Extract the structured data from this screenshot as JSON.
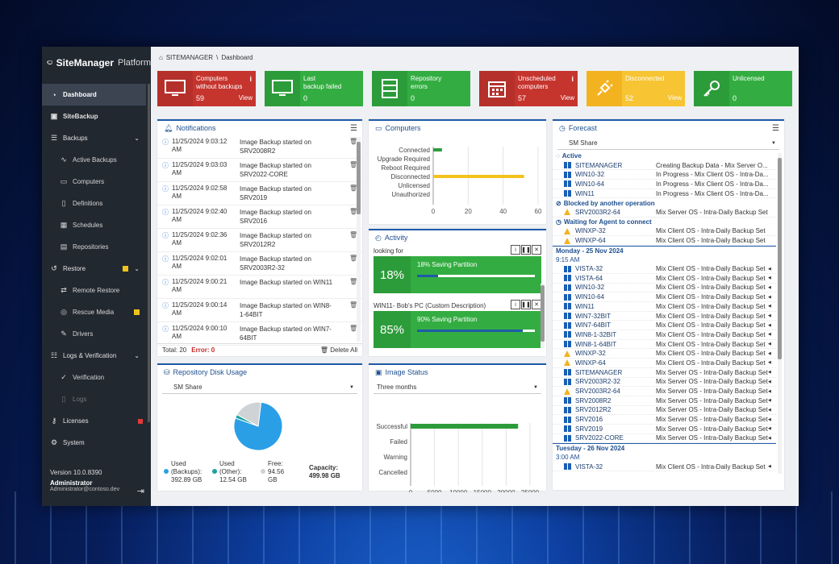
{
  "brand": {
    "name": "SiteManager",
    "suffix": "Platform"
  },
  "breadcrumb": {
    "root": "SITEMANAGER",
    "sep": "\\",
    "current": "Dashboard"
  },
  "sidebar": {
    "items": [
      {
        "label": "Dashboard"
      },
      {
        "label": "SiteBackup"
      },
      {
        "label": "Backups"
      },
      {
        "label": "Active Backups"
      },
      {
        "label": "Computers"
      },
      {
        "label": "Definitions"
      },
      {
        "label": "Schedules"
      },
      {
        "label": "Repositories"
      },
      {
        "label": "Restore"
      },
      {
        "label": "Remote Restore"
      },
      {
        "label": "Rescue Media"
      },
      {
        "label": "Drivers"
      },
      {
        "label": "Logs & Verification"
      },
      {
        "label": "Verification"
      },
      {
        "label": "Logs"
      },
      {
        "label": "Licenses"
      },
      {
        "label": "System"
      }
    ],
    "version": "Version 10.0.8390",
    "user": "Administrator",
    "email": "Administrator@contoso.dev"
  },
  "tiles": [
    {
      "l1": "Computers",
      "l2": "without backups",
      "count": "59",
      "view": "View",
      "alert": "i"
    },
    {
      "l1": "Last",
      "l2": "backup failed",
      "count": "0"
    },
    {
      "l1": "Repository",
      "l2": "errors",
      "count": "0"
    },
    {
      "l1": "Unscheduled",
      "l2": "computers",
      "count": "57",
      "view": "View",
      "alert": "i"
    },
    {
      "l1": "Disconnected",
      "l2": "",
      "count": "52",
      "view": "View"
    },
    {
      "l1": "Unlicensed",
      "l2": "",
      "count": "0"
    }
  ],
  "notifications": {
    "title": "Notifications",
    "items": [
      {
        "t1": "11/25/2024 9:03:12",
        "t2": "AM",
        "m1": "Image Backup started on",
        "m2": "SRV2008R2"
      },
      {
        "t1": "11/25/2024 9:03:03",
        "t2": "AM",
        "m1": "Image Backup started on",
        "m2": "SRV2022-CORE"
      },
      {
        "t1": "11/25/2024 9:02:58",
        "t2": "AM",
        "m1": "Image Backup started on",
        "m2": "SRV2019"
      },
      {
        "t1": "11/25/2024 9:02:40",
        "t2": "AM",
        "m1": "Image Backup started on",
        "m2": "SRV2016"
      },
      {
        "t1": "11/25/2024 9:02:36",
        "t2": "AM",
        "m1": "Image Backup started on",
        "m2": "SRV2012R2"
      },
      {
        "t1": "11/25/2024 9:02:01",
        "t2": "AM",
        "m1": "Image Backup started on",
        "m2": "SRV2003R2-32"
      },
      {
        "t1": "11/25/2024 9:00:21",
        "t2": "AM",
        "m1": "Image Backup started on WIN11",
        "m2": ""
      },
      {
        "t1": "11/25/2024 9:00:14",
        "t2": "AM",
        "m1": "Image Backup started on WIN8-",
        "m2": "1-64BIT"
      },
      {
        "t1": "11/25/2024 9:00:10",
        "t2": "AM",
        "m1": "Image Backup started on WIN7-",
        "m2": "64BIT"
      }
    ],
    "total": "Total: 20",
    "errors": "Error: 0",
    "delete_all": "Delete All"
  },
  "computers": {
    "title": "Computers"
  },
  "activity": {
    "title": "Activity",
    "cut_text": "looking for",
    "items": [
      {
        "pct": "18%",
        "label": "18% Saving Partition",
        "progress": 18
      },
      {
        "title": "WIN11- Bob's PC (Custom Description)",
        "pct": "85%",
        "label": "90% Saving Partition",
        "progress": 90
      }
    ]
  },
  "forecast": {
    "title": "Forecast",
    "select": "SM Share",
    "sec_active": "Active",
    "sec_blocked": "Blocked by another operation",
    "sec_waiting": "Waiting for Agent to connect",
    "day1": "Monday - 25 Nov 2024",
    "time1": "9:15 AM",
    "day2": "Tuesday - 26 Nov 2024",
    "time2": "3:00 AM",
    "active": [
      [
        "SITEMANAGER",
        "Creating Backup Data - Mix Server O..."
      ],
      [
        "WIN10-32",
        "In Progress - Mix Client OS - Intra-Da..."
      ],
      [
        "WIN10-64",
        "In Progress - Mix Client OS - Intra-Da..."
      ],
      [
        "WIN11",
        "In Progress - Mix Client OS - Intra-Da..."
      ]
    ],
    "blocked": [
      [
        "SRV2003R2-64",
        "Mix Server OS - Intra-Daily Backup Set"
      ]
    ],
    "waiting": [
      [
        "WINXP-32",
        "Mix Client OS - Intra-Daily Backup Set"
      ],
      [
        "WINXP-64",
        "Mix Client OS - Intra-Daily Backup Set"
      ]
    ],
    "monday": [
      [
        "VISTA-32",
        "Mix Client OS - Intra-Daily Backup Set",
        "w"
      ],
      [
        "VISTA-64",
        "Mix Client OS - Intra-Daily Backup Set",
        "w"
      ],
      [
        "WIN10-32",
        "Mix Client OS - Intra-Daily Backup Set",
        "w"
      ],
      [
        "WIN10-64",
        "Mix Client OS - Intra-Daily Backup Set",
        "w"
      ],
      [
        "WIN11",
        "Mix Client OS - Intra-Daily Backup Set",
        "w"
      ],
      [
        "WIN7-32BIT",
        "Mix Client OS - Intra-Daily Backup Set",
        "w"
      ],
      [
        "WIN7-64BIT",
        "Mix Client OS - Intra-Daily Backup Set",
        "w"
      ],
      [
        "WIN8-1-32BIT",
        "Mix Client OS - Intra-Daily Backup Set",
        "w"
      ],
      [
        "WIN8-1-64BIT",
        "Mix Client OS - Intra-Daily Backup Set",
        "w"
      ],
      [
        "WINXP-32",
        "Mix Client OS - Intra-Daily Backup Set",
        "a"
      ],
      [
        "WINXP-64",
        "Mix Client OS - Intra-Daily Backup Set",
        "a"
      ],
      [
        "SITEMANAGER",
        "Mix Server OS - Intra-Daily Backup Set",
        "w"
      ],
      [
        "SRV2003R2-32",
        "Mix Server OS - Intra-Daily Backup Set",
        "w"
      ],
      [
        "SRV2003R2-64",
        "Mix Server OS - Intra-Daily Backup Set",
        "a"
      ],
      [
        "SRV2008R2",
        "Mix Server OS - Intra-Daily Backup Set",
        "w"
      ],
      [
        "SRV2012R2",
        "Mix Server OS - Intra-Daily Backup Set",
        "w"
      ],
      [
        "SRV2016",
        "Mix Server OS - Intra-Daily Backup Set",
        "w"
      ],
      [
        "SRV2019",
        "Mix Server OS - Intra-Daily Backup Set",
        "w"
      ],
      [
        "SRV2022-CORE",
        "Mix Server OS - Intra-Daily Backup Set",
        "w"
      ]
    ],
    "tuesday": [
      [
        "VISTA-32",
        "Mix Client OS - Intra-Daily Backup Set",
        "w"
      ]
    ]
  },
  "repo": {
    "title": "Repository Disk Usage",
    "select": "SM Share",
    "legend": [
      {
        "l1": "Used",
        "l2": "(Backups):",
        "v": "392.89 GB",
        "color": "#2b9fe6"
      },
      {
        "l1": "Used",
        "l2": "(Other):",
        "v": "12.54 GB",
        "color": "#1aa3a0"
      },
      {
        "l1": "Free:",
        "l2": "94.56",
        "v": "GB",
        "color": "#cfd3d6"
      }
    ],
    "cap_label": "Capacity:",
    "cap_value": "499.98 GB"
  },
  "image_status": {
    "title": "Image Status",
    "select": "Three months"
  },
  "chart_data": [
    {
      "type": "bar",
      "orientation": "horizontal",
      "categories": [
        "Connected",
        "Upgrade Required",
        "Reboot Required",
        "Disconnected",
        "Unlicensed",
        "Unauthorized"
      ],
      "values": [
        5,
        0,
        0,
        52,
        0,
        0
      ],
      "colors": [
        "#2c9c3a",
        "#2c9c3a",
        "#2c9c3a",
        "#f3c21b",
        "#2c9c3a",
        "#2c9c3a"
      ],
      "xlim": [
        0,
        60
      ],
      "xticks": [
        0,
        20,
        40,
        60
      ]
    },
    {
      "type": "bar",
      "orientation": "horizontal",
      "categories": [
        "Successful",
        "Failed",
        "Warning",
        "Cancelled"
      ],
      "values": [
        22500,
        0,
        0,
        0
      ],
      "colors": [
        "#2c9c3a",
        "#c6342e",
        "#f3b321",
        "#999"
      ],
      "xlim": [
        0,
        25000
      ],
      "xticks": [
        0,
        5000,
        10000,
        15000,
        20000,
        25000
      ]
    },
    {
      "type": "pie",
      "labels": [
        "Used (Backups)",
        "Used (Other)",
        "Free"
      ],
      "values": [
        392.89,
        12.54,
        94.56
      ],
      "colors": [
        "#2b9fe6",
        "#1aa3a0",
        "#cfd3d6"
      ]
    }
  ]
}
